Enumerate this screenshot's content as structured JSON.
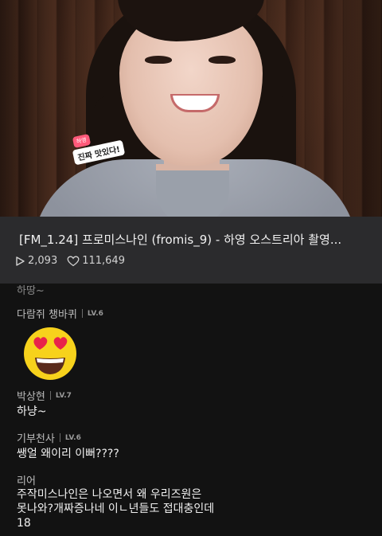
{
  "video": {
    "caption_badge": "하영",
    "caption": "진짜 맛있다!"
  },
  "post": {
    "title": "[FM_1.24] 프로미스나인 (fromis_9) - 하영 오스트리아 촬영...",
    "views": "2,093",
    "likes": "111,649"
  },
  "comments": {
    "previous_fragment": "하땅~",
    "items": [
      {
        "author": "다람쥐 챙바퀴",
        "level": "LV.6",
        "text": "",
        "emoji": "heart-eyes-emoji"
      },
      {
        "author": "박상현",
        "level": "LV.7",
        "text": "하냥~"
      },
      {
        "author": "기부천사",
        "level": "LV.6",
        "text": "쌩얼 왜이리 이뻐????"
      },
      {
        "author": "리어",
        "level": "",
        "text_lines": [
          "주작미스나인은 나오면서 왜 우리즈원은",
          "못나와?개짜증나네 이ㄴ년들도 접대충인데",
          "18"
        ]
      }
    ]
  },
  "colors": {
    "info_bar": "#2b2b2d",
    "comment_bg": "#121212",
    "emoji_yellow": "#f7d21c",
    "emoji_heart": "#e8234a"
  }
}
